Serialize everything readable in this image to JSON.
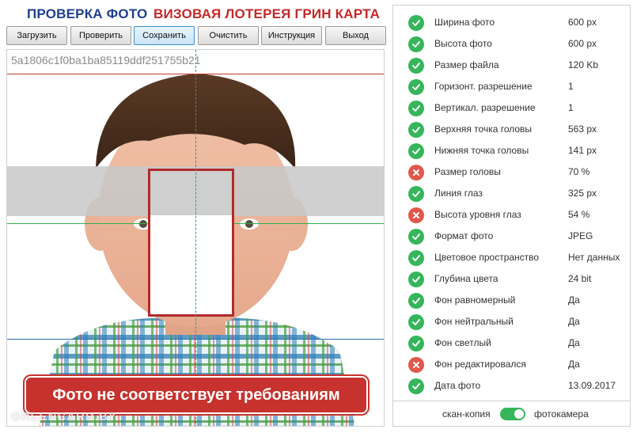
{
  "header": {
    "title_check": "ПРОВЕРКА ФОТО",
    "title_lottery": "ВИЗОВАЯ ЛОТЕРЕЯ ГРИН КАРТА"
  },
  "toolbar": {
    "load": "Загрузить",
    "check": "Проверить",
    "save": "Сохранить",
    "clear": "Очистить",
    "instruction": "Инструкция",
    "exit": "Выход"
  },
  "photo": {
    "hash": "5a1806c1f0ba1ba85119ddf251755b21",
    "alert": "Фото не соответствует требованиям",
    "watermark": "GREENCARD.BY"
  },
  "checks": [
    {
      "label": "Ширина фото",
      "value": "600 px",
      "status": "ok"
    },
    {
      "label": "Высота фото",
      "value": "600 px",
      "status": "ok"
    },
    {
      "label": "Размер файла",
      "value": "120 Kb",
      "status": "ok"
    },
    {
      "label": "Горизонт. разрешение",
      "value": "1",
      "status": "ok"
    },
    {
      "label": "Вертикал. разрешение",
      "value": "1",
      "status": "ok"
    },
    {
      "label": "Верхняя точка головы",
      "value": "563 px",
      "status": "ok"
    },
    {
      "label": "Нижняя точка головы",
      "value": "141 px",
      "status": "ok"
    },
    {
      "label": "Размер головы",
      "value": "70 %",
      "status": "bad"
    },
    {
      "label": "Линия глаз",
      "value": "325 px",
      "status": "ok"
    },
    {
      "label": "Высота уровня глаз",
      "value": "54 %",
      "status": "bad"
    },
    {
      "label": "Формат фото",
      "value": "JPEG",
      "status": "ok"
    },
    {
      "label": "Цветовое пространство",
      "value": "Нет данных",
      "status": "ok"
    },
    {
      "label": "Глубина цвета",
      "value": "24 bit",
      "status": "ok"
    },
    {
      "label": "Фон равномерный",
      "value": "Да",
      "status": "ok"
    },
    {
      "label": "Фон нейтральный",
      "value": "Да",
      "status": "ok"
    },
    {
      "label": "Фон светлый",
      "value": "Да",
      "status": "ok"
    },
    {
      "label": "Фон редактировался",
      "value": "Да",
      "status": "bad"
    },
    {
      "label": "Дата фото",
      "value": "13.09.2017",
      "status": "ok"
    }
  ],
  "mode": {
    "left": "скан-копия",
    "right": "фотокамера",
    "toggle_on": true
  },
  "colors": {
    "ok": "#36b55b",
    "bad": "#e2574c",
    "title_blue": "#1f3f8f",
    "title_red": "#c62828",
    "alert": "#c8322e"
  }
}
